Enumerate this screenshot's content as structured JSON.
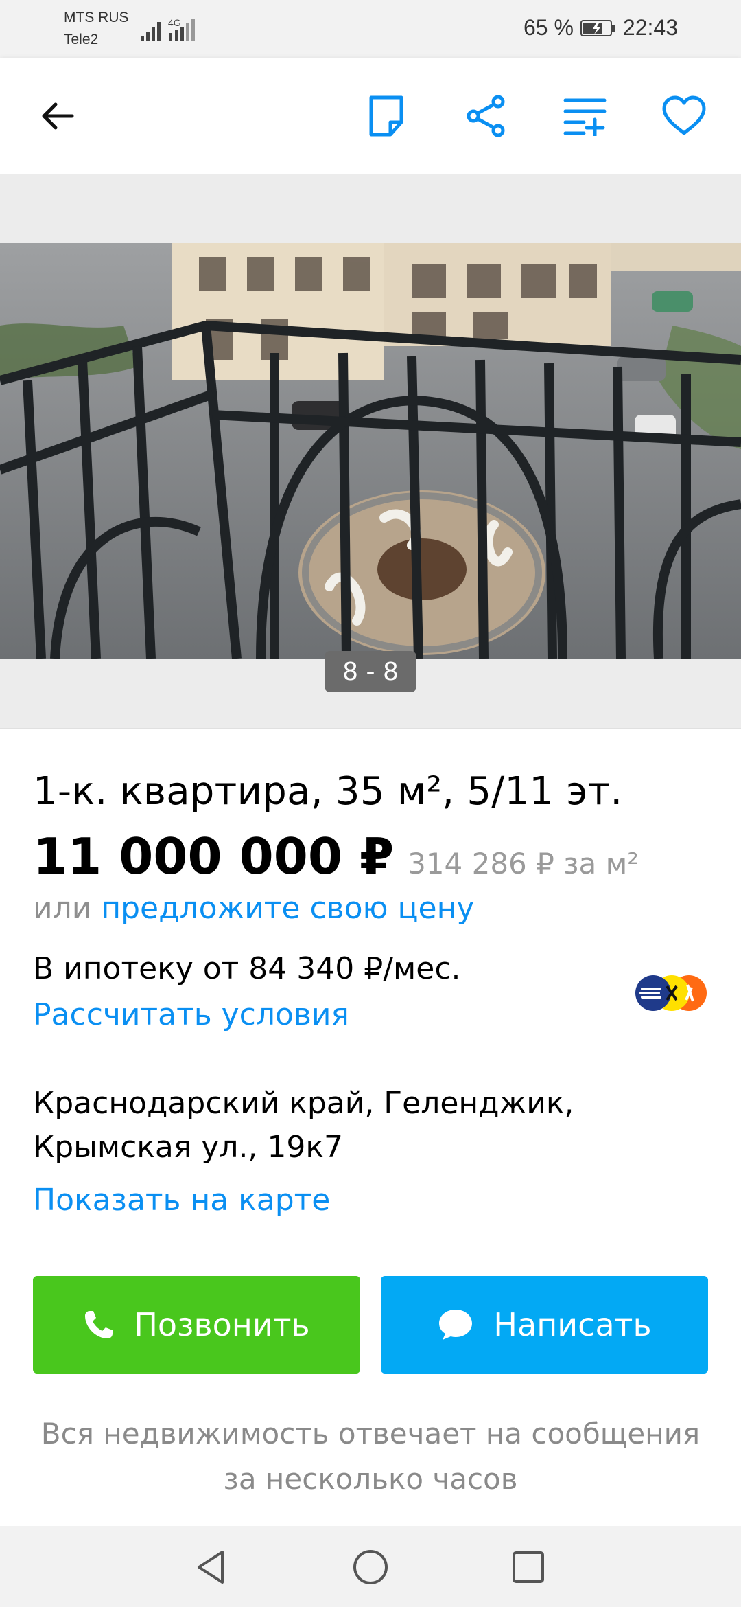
{
  "status_bar": {
    "carrier1": "MTS RUS",
    "carrier2": "Tele2",
    "network": "4G",
    "battery_percent": "65 %",
    "time": "22:43"
  },
  "app_bar": {
    "back_icon": "arrow-left-icon",
    "note_icon": "note-icon",
    "share_icon": "share-icon",
    "compare_icon": "add-to-list-icon",
    "favorite_icon": "heart-icon",
    "accent_color": "#0a8ff2"
  },
  "gallery": {
    "counter": "8 - 8"
  },
  "listing": {
    "title": "1-к. квартира, 35 м², 5/11 эт.",
    "price": "11 000 000 ₽",
    "price_per_m": "314 286 ₽ за м²",
    "offer_prefix": "или",
    "offer_link": "предложите свою цену",
    "mortgage": "В ипотеку от 84 340 ₽/мес.",
    "calc_link": "Рассчитать условия",
    "address": "Краснодарский край, Геленджик, Крымская ул., 19к7",
    "map_link": "Показать на карте"
  },
  "actions": {
    "call_label": "Позвонить",
    "write_label": "Написать",
    "call_color": "#49c71d",
    "write_color": "#03a9f4"
  },
  "note": {
    "line1": "Вся недвижимость отвечает на сообщения",
    "line2": "за несколько часов"
  },
  "nav": {
    "back": "triangle-back-icon",
    "home": "circle-home-icon",
    "recents": "square-recents-icon"
  }
}
